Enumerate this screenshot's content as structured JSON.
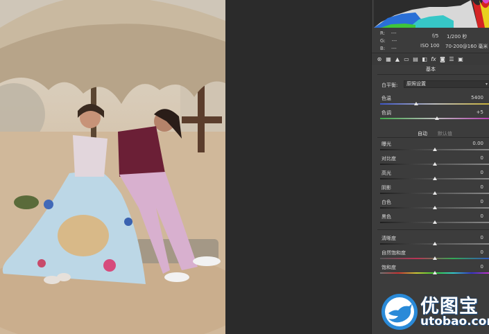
{
  "readout": {
    "r_label": "R:",
    "r_value": "---",
    "g_label": "G:",
    "g_value": "---",
    "b_label": "B:",
    "b_value": "---",
    "aperture": "f/5",
    "shutter": "1/200 秒",
    "iso": "ISO 100",
    "lens": "70-200@160 毫米"
  },
  "toolbar": {
    "icons": [
      "aperture-icon",
      "grid-icon",
      "mountain-icon",
      "split-icon",
      "strips-icon",
      "split-toning-icon",
      "fx-icon",
      "camera-icon",
      "sliders-icon",
      "presets-icon"
    ],
    "fx_glyph": "fx"
  },
  "section": {
    "title": "基本"
  },
  "white_balance": {
    "label": "白平衡:",
    "value": "原照设置"
  },
  "sliders_top": [
    {
      "label": "色温",
      "value": "5400",
      "level": 0.33
    },
    {
      "label": "色调",
      "value": "+5",
      "level": 0.52
    }
  ],
  "auto": {
    "auto_label": "自动",
    "default_label": "默认值"
  },
  "sliders_tone": [
    {
      "label": "曝光",
      "value": "0.00",
      "level": 0.5
    },
    {
      "label": "对比度",
      "value": "0",
      "level": 0.5
    },
    {
      "label": "高光",
      "value": "0",
      "level": 0.5
    },
    {
      "label": "阴影",
      "value": "0",
      "level": 0.5
    },
    {
      "label": "白色",
      "value": "0",
      "level": 0.5
    },
    {
      "label": "黑色",
      "value": "0",
      "level": 0.5
    }
  ],
  "sliders_presence": [
    {
      "label": "清晰度",
      "value": "0",
      "level": 0.5
    },
    {
      "label": "自然饱和度",
      "value": "0",
      "level": 0.5
    },
    {
      "label": "饱和度",
      "value": "0",
      "level": 0.5
    }
  ],
  "watermark": {
    "cn": "优图宝",
    "en": "utobao.com"
  },
  "colors": {
    "panel_bg": "#3c3c3c",
    "canvas_bg": "#2b2b2b",
    "temp_start": "#3d55c8",
    "temp_end": "#c9b23a",
    "tint_start": "#3fa84a",
    "tint_end": "#b43fb0",
    "watermark_blue": "#2a8ad8"
  }
}
